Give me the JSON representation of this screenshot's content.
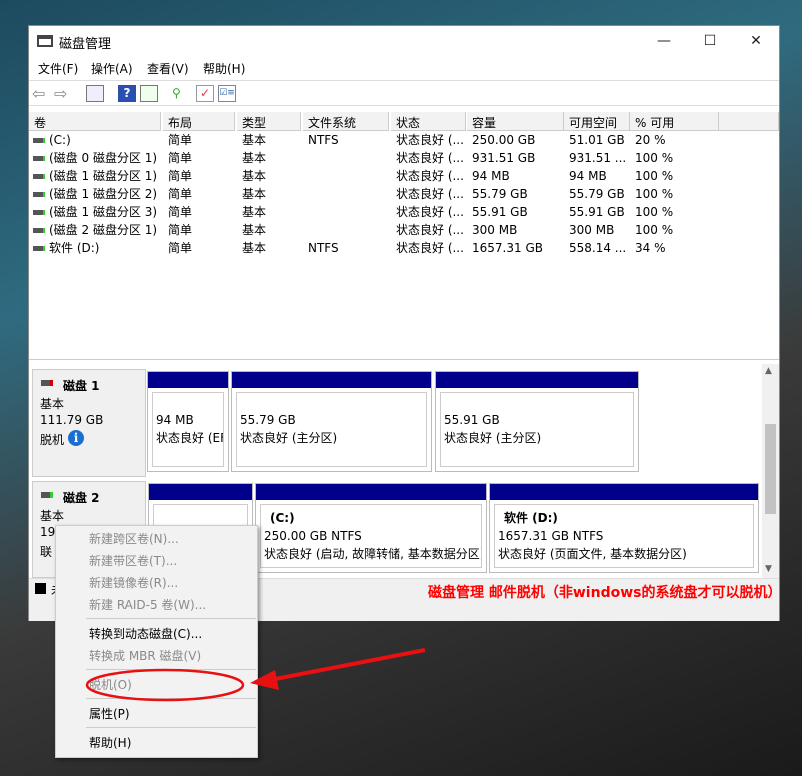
{
  "window": {
    "title": "磁盘管理",
    "minimize": "—",
    "maximize": "☐",
    "close": "✕"
  },
  "menu": [
    "文件(F)",
    "操作(A)",
    "查看(V)",
    "帮助(H)"
  ],
  "toolbar": [
    "back-icon",
    "forward-icon",
    "show-hide-console-icon",
    "help-icon",
    "show-action-pane-icon",
    "connect-icon",
    "properties-icon",
    "list-icon"
  ],
  "list": {
    "headers": [
      "卷",
      "布局",
      "类型",
      "文件系统",
      "状态",
      "容量",
      "可用空间",
      "% 可用"
    ],
    "rows": [
      [
        "(C:)",
        "简单",
        "基本",
        "NTFS",
        "状态良好 (...",
        "250.00 GB",
        "51.01 GB",
        "20 %"
      ],
      [
        "(磁盘 0 磁盘分区 1)",
        "简单",
        "基本",
        "",
        "状态良好 (...",
        "931.51 GB",
        "931.51 ...",
        "100 %"
      ],
      [
        "(磁盘 1 磁盘分区 1)",
        "简单",
        "基本",
        "",
        "状态良好 (...",
        "94 MB",
        "94 MB",
        "100 %"
      ],
      [
        "(磁盘 1 磁盘分区 2)",
        "简单",
        "基本",
        "",
        "状态良好 (...",
        "55.79 GB",
        "55.79 GB",
        "100 %"
      ],
      [
        "(磁盘 1 磁盘分区 3)",
        "简单",
        "基本",
        "",
        "状态良好 (...",
        "55.91 GB",
        "55.91 GB",
        "100 %"
      ],
      [
        "(磁盘 2 磁盘分区 1)",
        "简单",
        "基本",
        "",
        "状态良好 (...",
        "300 MB",
        "300 MB",
        "100 %"
      ],
      [
        "软件 (D:)",
        "简单",
        "基本",
        "NTFS",
        "状态良好 (...",
        "1657.31 GB",
        "558.14 ...",
        "34 %"
      ]
    ]
  },
  "disks": [
    {
      "name": "磁盘 1",
      "type": "基本",
      "size": "111.79 GB",
      "status": "脱机",
      "partitions": [
        {
          "l1": "94 MB",
          "l2": "状态良好 (EF"
        },
        {
          "l1": "55.79 GB",
          "l2": "状态良好 (主分区)"
        },
        {
          "l1": "55.91 GB",
          "l2": "状态良好 (主分区)"
        }
      ]
    },
    {
      "name": "磁盘 2",
      "type": "基本",
      "size": "19",
      "status": "联",
      "partitions": [
        {
          "title": "",
          "l1": "",
          "l2": ""
        },
        {
          "title": "(C:)",
          "l1": "250.00 GB NTFS",
          "l2": "状态良好 (启动, 故障转储, 基本数据分区)"
        },
        {
          "title": "软件  (D:)",
          "l1": "1657.31 GB NTFS",
          "l2": "状态良好 (页面文件, 基本数据分区)"
        }
      ]
    }
  ],
  "legend": {
    "label": "未"
  },
  "context_menu": [
    {
      "label": "新建跨区卷(N)...",
      "enabled": false
    },
    {
      "label": "新建带区卷(T)...",
      "enabled": false
    },
    {
      "label": "新建镜像卷(R)...",
      "enabled": false
    },
    {
      "label": "新建 RAID-5 卷(W)...",
      "enabled": false
    },
    {
      "label": "转换到动态磁盘(C)...",
      "enabled": true
    },
    {
      "label": "转换成 MBR 磁盘(V)",
      "enabled": false
    },
    {
      "label": "脱机(O)",
      "enabled": false
    },
    {
      "label": "属性(P)",
      "enabled": true
    },
    {
      "label": "帮助(H)",
      "enabled": true
    }
  ],
  "annotation": {
    "text": "磁盘管理 邮件脱机（非windows的系统盘才可以脱机）",
    "color": "#ff0000"
  },
  "colors": {
    "partition_bar": "#00008b"
  }
}
